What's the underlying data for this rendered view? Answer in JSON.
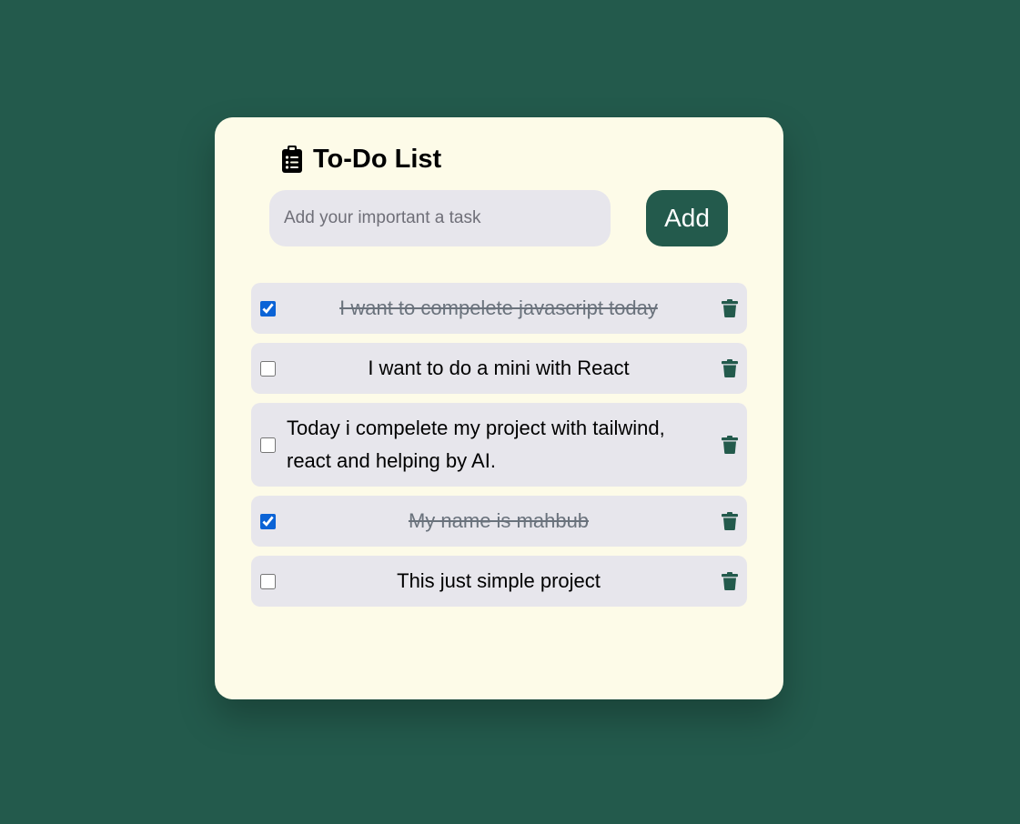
{
  "app": {
    "title": "To-Do List",
    "icon": "clipboard-list-icon"
  },
  "input": {
    "placeholder": "Add your important a task",
    "value": ""
  },
  "add_button": {
    "label": "Add"
  },
  "tasks": [
    {
      "text": "I want to compelete javascript today",
      "done": true
    },
    {
      "text": "I want to do a mini with React",
      "done": false
    },
    {
      "text": "Today i compelete my project with tailwind, react and helping by AI.",
      "done": false
    },
    {
      "text": "My name is mahbub",
      "done": true
    },
    {
      "text": "This just simple project",
      "done": false
    }
  ],
  "colors": {
    "background": "#235a4c",
    "card": "#fdfbe8",
    "item": "#e7e6ec",
    "accent": "#235a4c",
    "check": "#0b63d6"
  }
}
